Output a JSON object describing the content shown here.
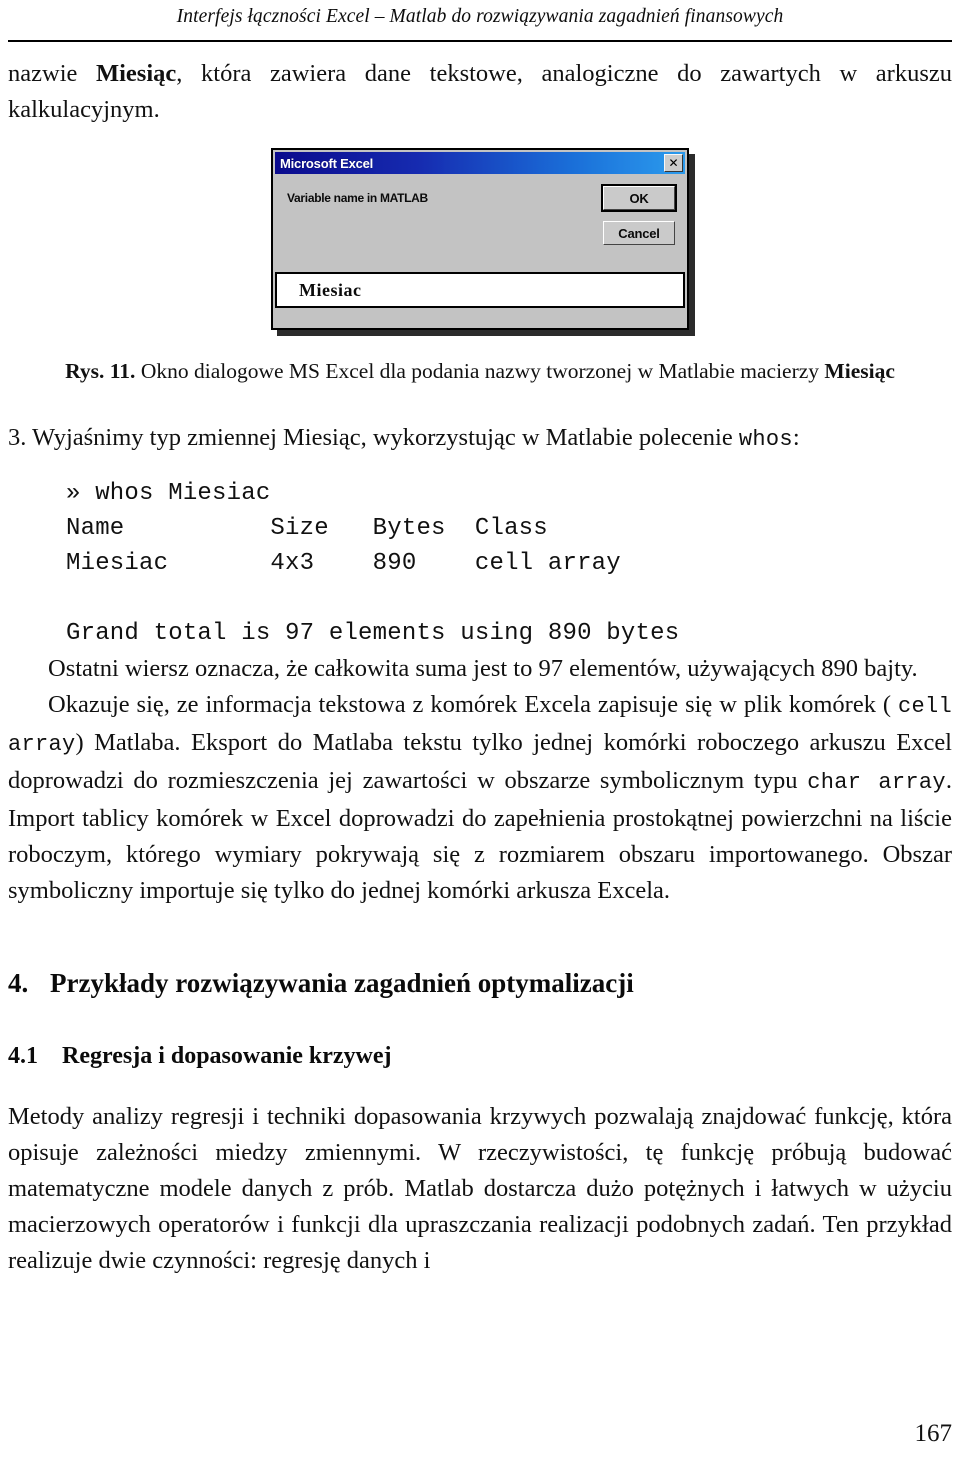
{
  "header": {
    "running_title": "Interfejs łączności Excel – Matlab do rozwiązywania zagadnień finansowych"
  },
  "intro_paragraph": {
    "before_bold": "nazwie ",
    "bold": "Miesiąc",
    "after_bold": ", która zawiera dane tekstowe, analogiczne do zawartych w arkuszu kalkulacyjnym."
  },
  "figure": {
    "dialog": {
      "title": "Microsoft Excel",
      "close_label": "✕",
      "prompt": "Variable name in MATLAB",
      "ok_label": "OK",
      "cancel_label": "Cancel",
      "input_value": "Miesiac"
    },
    "caption": {
      "label": "Rys. 11.",
      "text": " Okno dialogowe MS Excel dla podania nazwy tworzonej w Matlabie macierzy ",
      "bold_tail": "Miesiąc"
    }
  },
  "step3": {
    "text": "3. Wyjaśnimy typ zmiennej Miesiąc, wykorzystując w Matlabie polecenie ",
    "code": "whos",
    "tail": ":"
  },
  "console": {
    "lines": [
      "» whos Miesiac",
      "Name          Size   Bytes  Class",
      "Miesiac       4x3    890    cell array",
      "",
      "Grand total is 97 elements using 890 bytes"
    ]
  },
  "paragraphs": {
    "p1": "Ostatni wiersz oznacza, że całkowita suma jest to 97 elementów, używających 890 bajty.",
    "p2_a": "Okazuje się, ze informacja tekstowa z komórek Excela zapisuje się w plik komórek ( ",
    "p2_code1": "cell array",
    "p2_b": ") Matlaba. Eksport do Matlaba tekstu tylko jednej komórki roboczego arkuszu Excel doprowadzi do rozmieszczenia jej zawartości w obszarze symbolicznym typu ",
    "p2_code2": "char array",
    "p2_c": ". Import tablicy komórek w Excel doprowadzi do zapełnienia prostokątnej powierzchni na liście roboczym, którego wymiary pokrywają się z rozmiarem obszaru importowanego. Obszar symboliczny importuje się tylko do jednej komórki arkusza Excela."
  },
  "sections": {
    "s4_num": "4.",
    "s4_title": "Przykłady rozwiązywania zagadnień optymalizacji",
    "s41_num": "4.1",
    "s41_title": "Regresja i dopasowanie krzywej"
  },
  "closing_paragraph": "Metody analizy regresji i techniki dopasowania krzywych pozwalają znajdować funkcję, która opisuje zależności miedzy zmiennymi. W rzeczywistości, tę funkcję próbują budować matematyczne modele danych z prób. Matlab dostarcza dużo potężnych i łatwych w użyciu macierzowych operatorów i funkcji dla upraszczania realizacji podobnych zadań. Ten przykład realizuje dwie czynności: regresję danych i",
  "page_number": "167"
}
